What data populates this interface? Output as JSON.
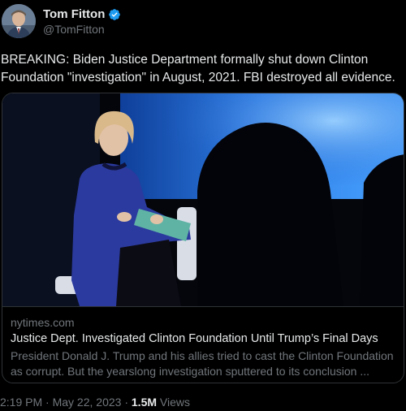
{
  "author": {
    "display_name": "Tom Fitton",
    "handle": "@TomFitton",
    "verified": true
  },
  "tweet": {
    "text": "BREAKING: Biden Justice Department formally shut down Clinton Foundation \"investigation\" in August, 2021. FBI destroyed all evidence."
  },
  "link_card": {
    "domain": "nytimes.com",
    "title": "Justice Dept. Investigated Clinton Foundation Until Trump’s Final Days",
    "description": "President Donald J. Trump and his allies tried to cast the Clinton Foundation as corrupt. But the yearslong investigation sputtered to its conclusion ..."
  },
  "meta": {
    "time": "2:19 PM",
    "date": "May 22, 2023",
    "separator": "·",
    "views_count": "1.5M",
    "views_label": "Views"
  },
  "colors": {
    "background": "#000000",
    "text_primary": "#e7e9ea",
    "text_secondary": "#71767b",
    "verified_blue": "#1d9bf0",
    "border": "#2f3336"
  }
}
